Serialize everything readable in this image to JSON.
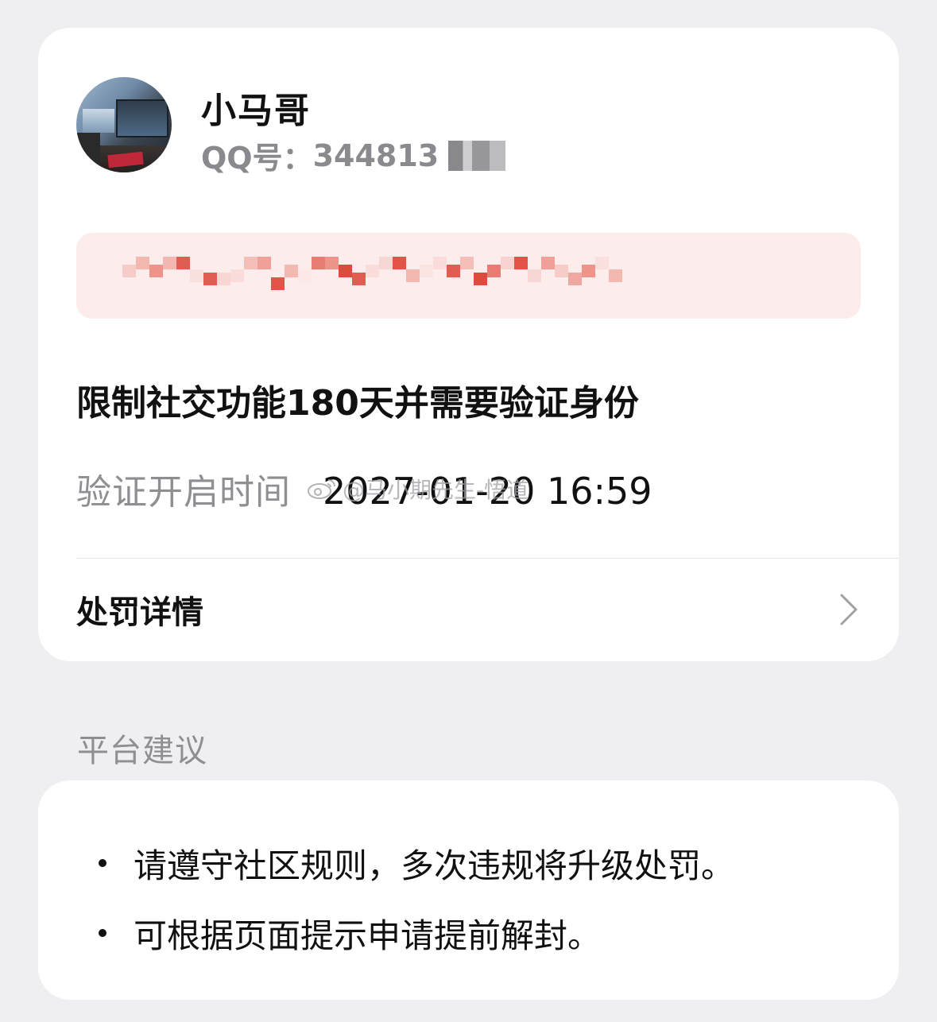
{
  "profile": {
    "nickname": "小马哥",
    "qq_label": "QQ号：",
    "qq_number": "344813"
  },
  "notice": {
    "text": "",
    "bg_color": "#fdecec",
    "pixel_colors": [
      "#f6c9c6",
      "#e8766c",
      "#f2b5ad",
      "#e0544a",
      "#f7d6d3",
      "#ee8f85",
      "#e34b3e",
      "#f9dedc",
      "#db4236",
      "#f4bdb6",
      "#ef9c93",
      "#fbe5e3"
    ]
  },
  "penalty": {
    "title": "限制社交功能180天并需要验证身份",
    "verify_label": "验证开启时间",
    "verify_value": "2027-01-20 16:59"
  },
  "watermark": {
    "text": "@马小期先生-悟道",
    "icon": "weibo-icon"
  },
  "detail": {
    "label": "处罚详情",
    "icon": "chevron-right-icon"
  },
  "advice": {
    "section_title": "平台建议",
    "items": [
      "请遵守社区规则，多次违规将升级处罚。",
      "可根据页面提示申请提前解封。"
    ]
  }
}
